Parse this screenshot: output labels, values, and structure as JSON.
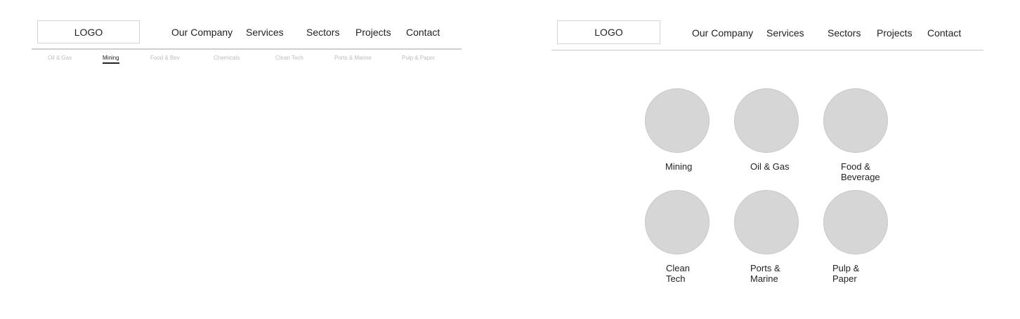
{
  "left_view": {
    "logo": "LOGO",
    "nav": [
      "Our Company",
      "Services",
      "Sectors",
      "Projects",
      "Contact"
    ],
    "subnav": {
      "items": [
        "Oil & Gas",
        "Mining",
        "Food & Bev",
        "Chemicals",
        "Clean Tech",
        "Ports & Marine",
        "Pulp & Paper"
      ],
      "active": "Mining"
    }
  },
  "right_view": {
    "logo": "LOGO",
    "nav": [
      "Our Company",
      "Services",
      "Sectors",
      "Projects",
      "Contact"
    ],
    "sectors": [
      {
        "label": "Mining"
      },
      {
        "label": "Oil & Gas"
      },
      {
        "label": "Food &\nBeverage"
      },
      {
        "label": "Clean\nTech"
      },
      {
        "label": "Ports &\nMarine"
      },
      {
        "label": "Pulp &\nPaper"
      }
    ]
  },
  "colors": {
    "circle_fill": "#d6d6d6",
    "inactive_subnav": "#bdbdbd",
    "text": "#222222"
  }
}
